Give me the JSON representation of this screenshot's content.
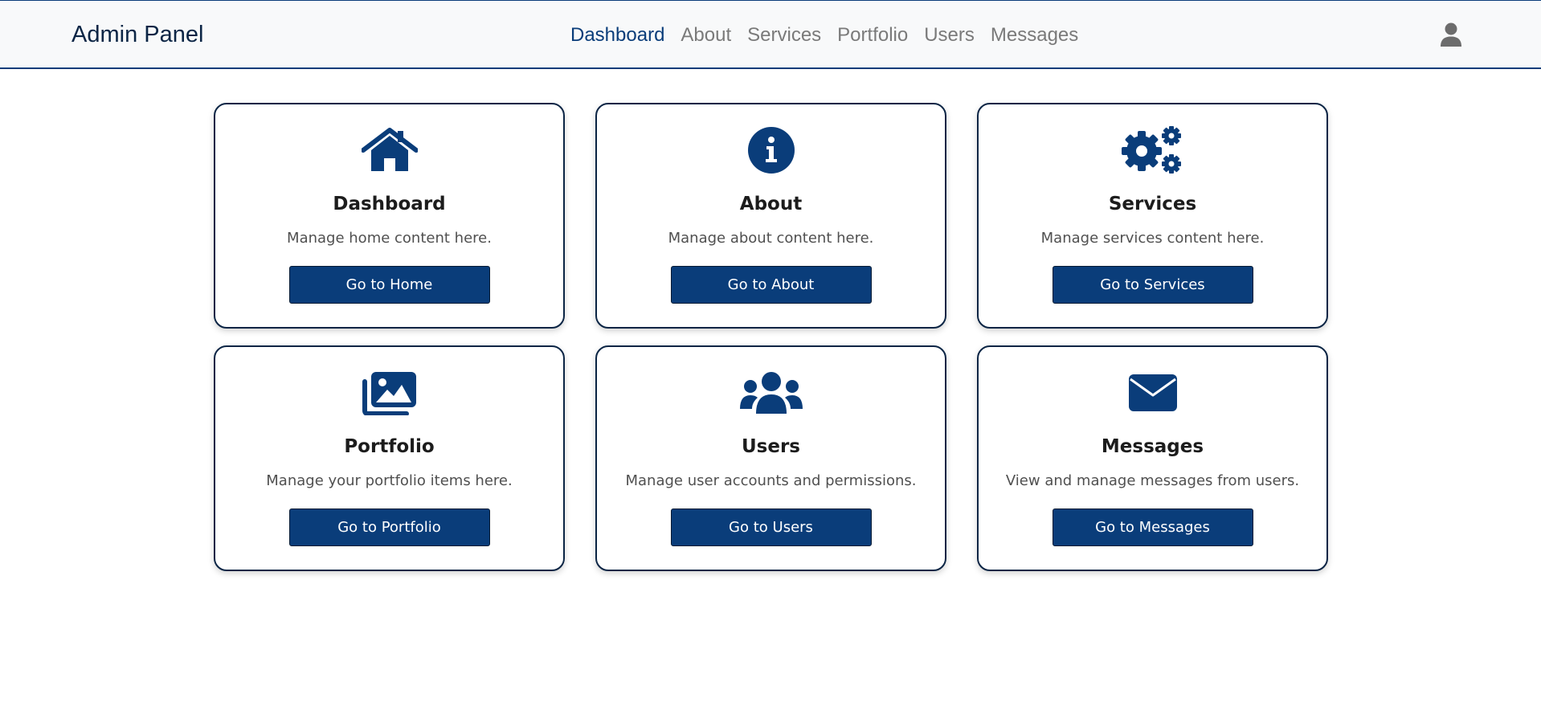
{
  "brand": "Admin Panel",
  "nav": {
    "items": [
      {
        "label": "Dashboard",
        "active": true
      },
      {
        "label": "About",
        "active": false
      },
      {
        "label": "Services",
        "active": false
      },
      {
        "label": "Portfolio",
        "active": false
      },
      {
        "label": "Users",
        "active": false
      },
      {
        "label": "Messages",
        "active": false
      }
    ],
    "profile_icon": "user-icon"
  },
  "cards": [
    {
      "icon": "home-icon",
      "title": "Dashboard",
      "text": "Manage home content here.",
      "button": "Go to Home"
    },
    {
      "icon": "info-icon",
      "title": "About",
      "text": "Manage about content here.",
      "button": "Go to About"
    },
    {
      "icon": "gears-icon",
      "title": "Services",
      "text": "Manage services content here.",
      "button": "Go to Services"
    },
    {
      "icon": "images-icon",
      "title": "Portfolio",
      "text": "Manage your portfolio items here.",
      "button": "Go to Portfolio"
    },
    {
      "icon": "users-icon",
      "title": "Users",
      "text": "Manage user accounts and permissions.",
      "button": "Go to Users"
    },
    {
      "icon": "envelope-icon",
      "title": "Messages",
      "text": "View and manage messages from users.",
      "button": "Go to Messages"
    }
  ],
  "colors": {
    "primary": "#0a3d7a",
    "navbar_bg": "#f8f9fa",
    "card_border": "#0b2545"
  }
}
